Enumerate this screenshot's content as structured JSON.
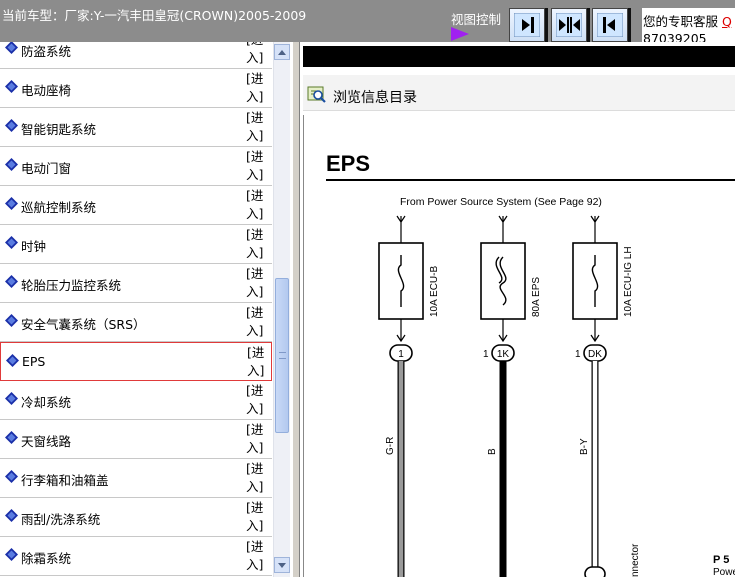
{
  "header": {
    "vehicle": "当前车型：厂家:Y-一汽丰田皇冠(CROWN)2005-2009",
    "view_control_label": "视图控制",
    "service_text": "您的专职客服",
    "service_link": "Q",
    "service_phone": "87039205"
  },
  "view_buttons": [
    {
      "name": "dock-right",
      "icon": "arrow-right-bar-icon"
    },
    {
      "name": "split-center",
      "icon": "split-arrows-icon"
    },
    {
      "name": "dock-left",
      "icon": "arrow-left-bar-icon"
    }
  ],
  "sidebar": {
    "enter_label": "[进入]",
    "items": [
      {
        "label": "防盗系统",
        "selected": false
      },
      {
        "label": "电动座椅",
        "selected": false
      },
      {
        "label": "智能钥匙系统",
        "selected": false
      },
      {
        "label": "电动门窗",
        "selected": false
      },
      {
        "label": "巡航控制系统",
        "selected": false
      },
      {
        "label": "时钟",
        "selected": false
      },
      {
        "label": "轮胎压力监控系统",
        "selected": false
      },
      {
        "label": "安全气囊系统（SRS）",
        "selected": false
      },
      {
        "label": "EPS",
        "selected": true
      },
      {
        "label": "冷却系统",
        "selected": false
      },
      {
        "label": "天窗线路",
        "selected": false
      },
      {
        "label": "行李箱和油箱盖",
        "selected": false
      },
      {
        "label": "雨刮/洗涤系统",
        "selected": false
      },
      {
        "label": "除霜系统",
        "selected": false
      }
    ]
  },
  "content": {
    "browse_label": "浏览信息目录"
  },
  "diagram": {
    "title": "EPS",
    "source_note": "From Power Source System (See Page 92)",
    "fuses": [
      {
        "label": "10A ECU-B",
        "connector": "1",
        "pin": "",
        "wire": "G-R",
        "wire_color": "#9a9a9a"
      },
      {
        "label": "80A EPS",
        "connector": "1K",
        "pin": "1",
        "wire": "B",
        "wire_color": "#000000"
      },
      {
        "label": "10A ECU-IG LH",
        "connector": "DK",
        "pin": "1",
        "wire": "B-Y",
        "wire_color": "#000000"
      }
    ],
    "page_label": "P 5",
    "page_sub": "Powe",
    "connector_note": "nnector"
  }
}
